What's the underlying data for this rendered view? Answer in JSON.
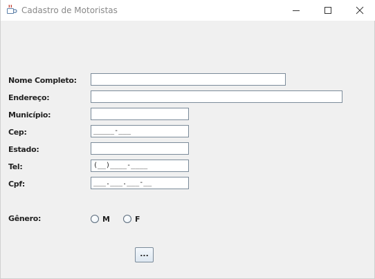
{
  "window": {
    "title": "Cadastro de Motoristas"
  },
  "form": {
    "nome": {
      "label": "Nome Completo:",
      "value": ""
    },
    "endereco": {
      "label": "Endereço:",
      "value": ""
    },
    "municipio": {
      "label": "Município:",
      "value": ""
    },
    "cep": {
      "label": "Cep:",
      "value": "_____-___"
    },
    "estado": {
      "label": "Estado:",
      "value": ""
    },
    "tel": {
      "label": "Tel:",
      "value": "(__)____-____"
    },
    "cpf": {
      "label": "Cpf:",
      "value": "___.___.___-__"
    },
    "genero": {
      "label": "Gênero:",
      "options": [
        "M",
        "F"
      ]
    },
    "submit_label": "..."
  },
  "icons": {
    "app": "java-cup-icon",
    "minimize": "minimize-icon",
    "maximize": "maximize-icon",
    "close": "close-icon"
  }
}
